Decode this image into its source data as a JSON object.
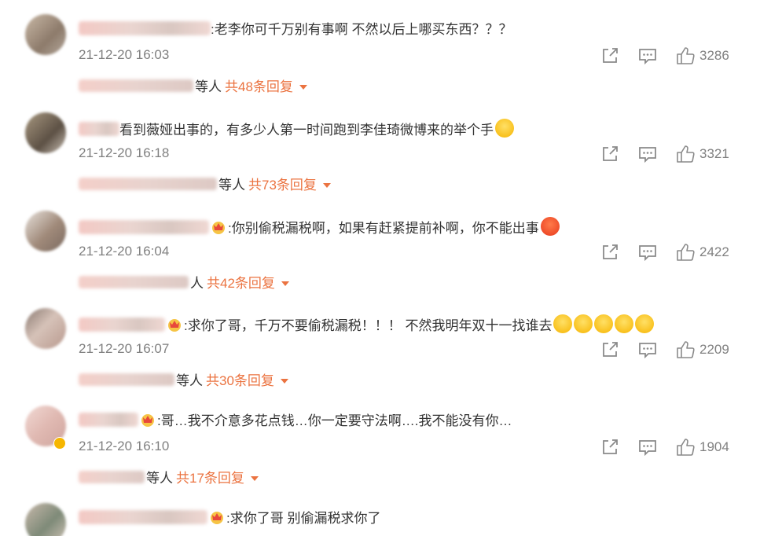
{
  "comments": [
    {
      "text": ":老李你可千万别有事啊 不然以后上哪买东西？？？",
      "time": "21-12-20 16:03",
      "likes": "3286",
      "reply_etc": "等人",
      "reply_total": "共48条回复",
      "emojis": [],
      "badge": false
    },
    {
      "text": "看到薇娅出事的，有多少人第一时间跑到李佳琦微博来的举个手",
      "time": "21-12-20 16:18",
      "likes": "3321",
      "reply_etc": "等人",
      "reply_total": "共73条回复",
      "emojis": [
        "laugh-cry-emoji"
      ],
      "badge": false
    },
    {
      "text": ":你别偷税漏税啊，如果有赶紧提前补啊，你不能出事",
      "time": "21-12-20 16:04",
      "likes": "2422",
      "reply_etc": "人",
      "reply_total": "共42条回复",
      "emojis": [
        "angry-emoji"
      ],
      "badge": true
    },
    {
      "text": ":求你了哥，千万不要偷税漏税！！！ 不然我明年双十一找谁去",
      "time": "21-12-20 16:07",
      "likes": "2209",
      "reply_etc": "等人",
      "reply_total": "共30条回复",
      "emojis": [
        "cry-emoji",
        "cry-emoji",
        "cry-emoji",
        "cry-emoji",
        "cry-emoji"
      ],
      "badge": true
    },
    {
      "text": ":哥…我不介意多花点钱…你一定要守法啊….我不能没有你…",
      "time": "21-12-20 16:10",
      "likes": "1904",
      "reply_etc": "等人",
      "reply_total": "共17条回复",
      "emojis": [],
      "badge": true
    },
    {
      "text": ":求你了哥 别偷漏税求你了",
      "badge": true
    }
  ],
  "colors": {
    "accent": "#eb7340",
    "meta": "#808080",
    "text": "#333333"
  },
  "icons": {
    "share": "share-icon",
    "comment": "comment-icon",
    "like": "thumbs-up-icon"
  }
}
